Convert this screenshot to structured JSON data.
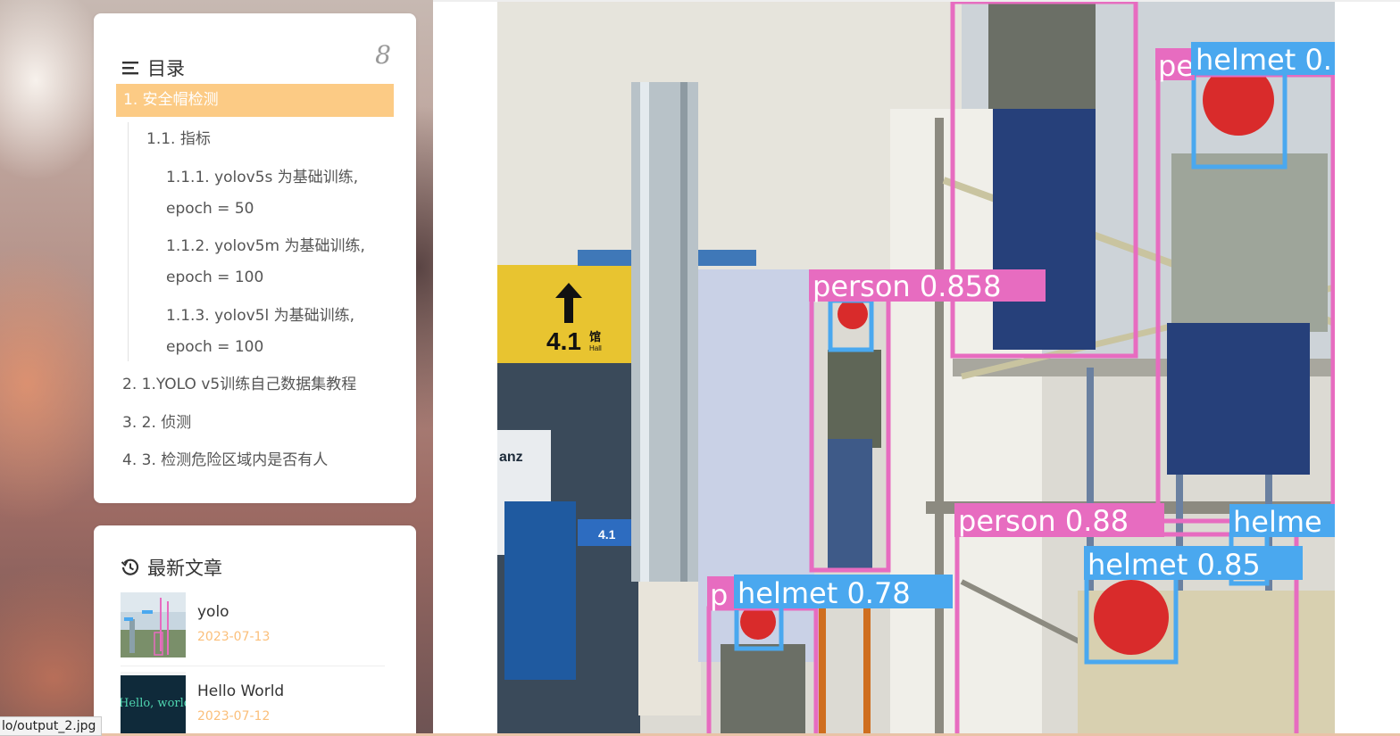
{
  "toc": {
    "title": "目录",
    "count": "8",
    "active_item": "1. 安全帽检测",
    "items": [
      {
        "label": "1.1. 指标"
      },
      {
        "label": "1.1.1. yolov5s 为基础训练,"
      },
      {
        "label": "epoch = 50"
      },
      {
        "label": "1.1.2. yolov5m 为基础训练,"
      },
      {
        "label": "epoch = 100"
      },
      {
        "label": "1.1.3. yolov5l 为基础训练,"
      },
      {
        "label": "epoch = 100"
      },
      {
        "label": "2. 1.YOLO v5训练自己数据集教程"
      },
      {
        "label": "3. 2. 侦测"
      },
      {
        "label": "4. 3. 检测危险区域内是否有人"
      }
    ]
  },
  "recent": {
    "title": "最新文章",
    "posts": [
      {
        "title": "yolo",
        "date": "2023-07-13"
      },
      {
        "title": "Hello World",
        "date": "2023-07-12",
        "thumb_text": "Hello, world"
      }
    ]
  },
  "image": {
    "detections": [
      {
        "label": "helmet 0.",
        "color": "#4aa8ef"
      },
      {
        "label": "pe",
        "color": "#e76cc0"
      },
      {
        "label": "person 0.858",
        "color": "#e76cc0"
      },
      {
        "label": "person 0.88",
        "color": "#e76cc0"
      },
      {
        "label": "helme",
        "color": "#4aa8ef"
      },
      {
        "label": "helmet 0.85",
        "color": "#4aa8ef"
      },
      {
        "label": "helmet 0.78",
        "color": "#4aa8ef"
      },
      {
        "label": "p",
        "color": "#e76cc0"
      }
    ],
    "signage": {
      "hall": "4.1",
      "hall_cn": "馆",
      "hall_en": "Hall",
      "brand": "anz",
      "bottom_num": "4.1"
    }
  },
  "status_url": "lo/output_2.jpg",
  "colors": {
    "accent": "#fccb85",
    "date": "#fbbf7a",
    "person_box": "#e76cc0",
    "helmet_box": "#4aa8ef"
  }
}
